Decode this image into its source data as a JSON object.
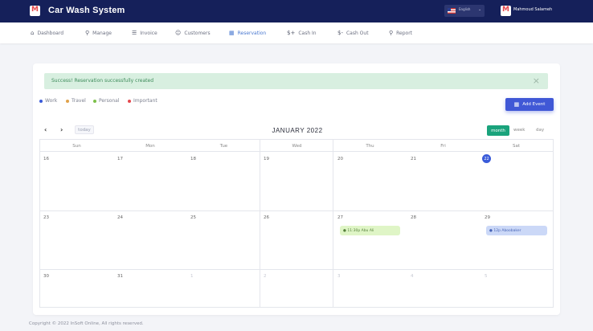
{
  "app": {
    "title": "Car Wash System",
    "logo_letter": "M"
  },
  "header": {
    "language": "English",
    "user_name": "Mahmoud Salameh"
  },
  "nav": [
    {
      "label": "Dashboard",
      "icon": "home-icon",
      "glyph": "⌂"
    },
    {
      "label": "Manage",
      "icon": "wrench-icon",
      "glyph": "⚲"
    },
    {
      "label": "Invoice",
      "icon": "invoice-icon",
      "glyph": "☰"
    },
    {
      "label": "Customers",
      "icon": "users-icon",
      "glyph": "☺"
    },
    {
      "label": "Reservation",
      "icon": "calendar-icon",
      "glyph": "▦"
    },
    {
      "label": "Cash In",
      "icon": "cash-in-icon",
      "glyph": "$+"
    },
    {
      "label": "Cash Out",
      "icon": "cash-out-icon",
      "glyph": "$-"
    },
    {
      "label": "Report",
      "icon": "report-icon",
      "glyph": "⚲"
    }
  ],
  "alert": {
    "text": "Success! Reservation successfully created",
    "close": "×"
  },
  "legend": [
    {
      "label": "Work",
      "color": "#3a5bd9"
    },
    {
      "label": "Travel",
      "color": "#e0a24a"
    },
    {
      "label": "Personal",
      "color": "#7cc04a"
    },
    {
      "label": "Important",
      "color": "#e5484d"
    }
  ],
  "toolbar": {
    "add_event": "Add Event",
    "today": "today",
    "prev": "‹",
    "next": "›"
  },
  "calendar": {
    "title": "JANUARY 2022",
    "views": {
      "month": "month",
      "week": "week",
      "day": "day"
    },
    "weekdays": [
      "Sun",
      "Mon",
      "Tue",
      "Wed",
      "Thu",
      "Fri",
      "Sat"
    ],
    "weeks": [
      [
        "16",
        "17",
        "18",
        "19",
        "20",
        "21",
        "22"
      ],
      [
        "23",
        "24",
        "25",
        "26",
        "27",
        "28",
        "29"
      ],
      [
        "30",
        "31",
        "1",
        "2",
        "3",
        "4",
        "5"
      ]
    ],
    "today": "22",
    "events": [
      {
        "day": "27",
        "text": "● 11:30p  Abu Ali",
        "color": "green"
      },
      {
        "day": "29",
        "text": "● 12p  Aboobaker",
        "color": "blue"
      }
    ]
  },
  "footer": {
    "text": "Copyright © 2022 InSoft Online, All rights reserved."
  }
}
